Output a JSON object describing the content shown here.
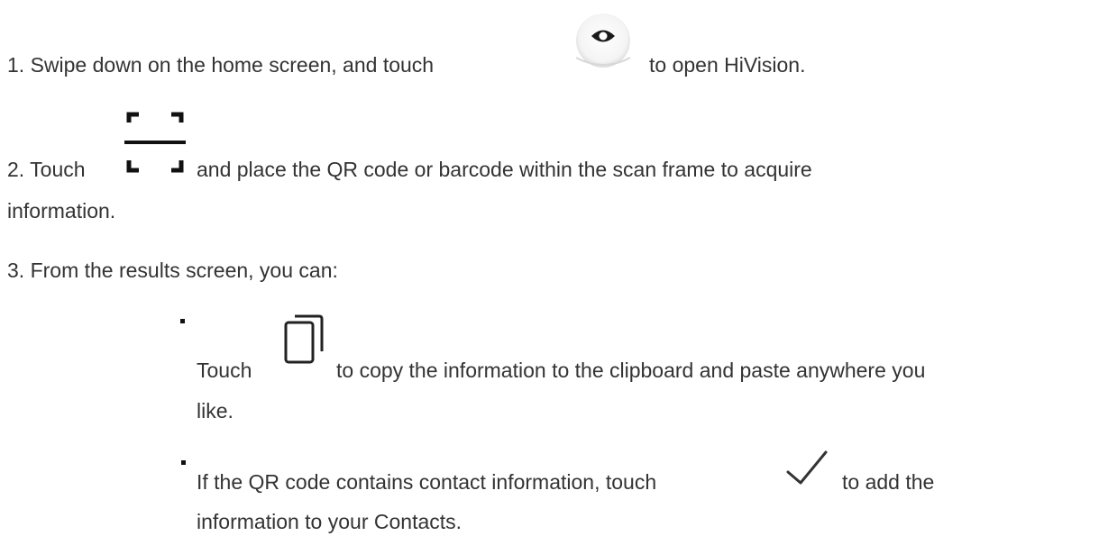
{
  "steps": {
    "step1": {
      "prefix": "1. Swipe down on the home screen, and touch",
      "suffix": "to open HiVision.",
      "icon": "hivision-eye-icon"
    },
    "step2": {
      "prefix": "2. Touch",
      "suffix": "and place the QR code or barcode within the scan frame to acquire",
      "continuation": "information.",
      "icon": "scan-frame-icon"
    },
    "step3": {
      "text": "3. From the results screen, you can:"
    }
  },
  "options": [
    {
      "prefix": "Touch",
      "suffix": "to copy the information to the clipboard and paste anywhere you",
      "continuation": "like.",
      "icon": "copy-icon"
    },
    {
      "prefix": "If the QR code contains contact information, touch",
      "suffix": "to add the",
      "continuation": "information to your Contacts.",
      "icon": "checkmark-icon"
    }
  ],
  "colors": {
    "text": "#333333",
    "icon": "#222222"
  }
}
